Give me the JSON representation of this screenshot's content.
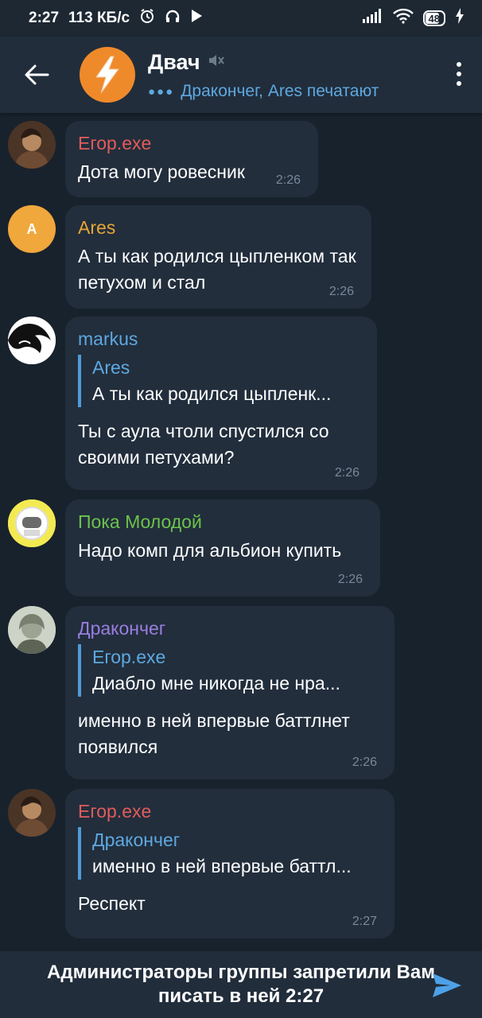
{
  "status_bar": {
    "time": "2:27",
    "speed": "113 КБ/с",
    "battery": "48"
  },
  "header": {
    "title": "Двач",
    "typing_status": "Дракончег, Ares печатают"
  },
  "messages": [
    {
      "sender": "Егор.exe",
      "sender_color": "#e35b5b",
      "text": "Дота могу ровесник",
      "time": "2:26"
    },
    {
      "sender": "Ares",
      "sender_color": "#e8a534",
      "avatar_letter": "A",
      "text": "А ты как родился цыпленком так петухом и стал",
      "time": "2:26"
    },
    {
      "sender": "markus",
      "sender_color": "#5ea8e0",
      "reply_name": "Ares",
      "reply_text": "А ты как родился цыпленк...",
      "text": "Ты с аула чтоли спустился со своими петухами?",
      "time": "2:26"
    },
    {
      "sender": "Пока Молодой",
      "sender_color": "#6cc34b",
      "text": "Надо комп для альбион купить",
      "time": "2:26"
    },
    {
      "sender": "Дракончег",
      "sender_color": "#9a7ee0",
      "reply_name": "Егор.exe",
      "reply_text": "Диабло мне никогда не нра...",
      "text": "именно в ней впервые баттлнет появился",
      "time": "2:26"
    },
    {
      "sender": "Егор.exe",
      "sender_color": "#e35b5b",
      "reply_name": "Дракончег",
      "reply_text": "именно в ней впервые баттл...",
      "text": "Респект",
      "time": "2:27"
    }
  ],
  "footer": {
    "restriction_text": "Администраторы группы запретили Вам писать в ней 2:27"
  }
}
